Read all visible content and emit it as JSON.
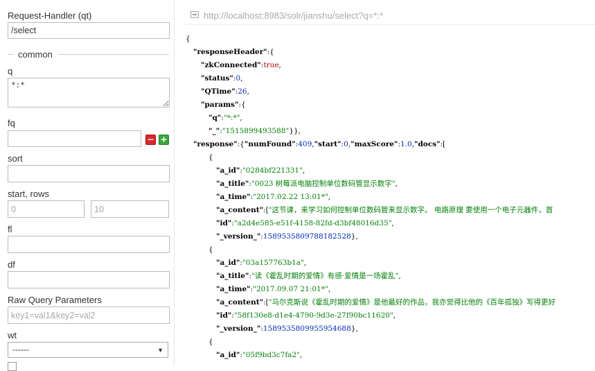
{
  "form": {
    "request_handler": {
      "label": "Request-Handler (qt)",
      "value": "/select"
    },
    "section_title": "common",
    "q": {
      "label": "q",
      "value": "*:*"
    },
    "fq": {
      "label": "fq",
      "value": ""
    },
    "sort": {
      "label": "sort",
      "value": ""
    },
    "start_rows": {
      "label": "start, rows",
      "start_placeholder": "0",
      "rows_placeholder": "10"
    },
    "fl": {
      "label": "fl",
      "value": ""
    },
    "df": {
      "label": "df",
      "value": ""
    },
    "raw_query": {
      "label": "Raw Query Parameters",
      "placeholder": "key1=val1&key2=val2"
    },
    "wt": {
      "label": "wt",
      "selected": "------"
    }
  },
  "url": "http://localhost:8983/solr/jianshu/select?q=*:*",
  "response_lines": [
    {
      "indent": 0,
      "tokens": [
        {
          "t": "p",
          "v": "{"
        }
      ]
    },
    {
      "indent": 1,
      "tokens": [
        {
          "t": "k",
          "v": "\"responseHeader\""
        },
        {
          "t": "p",
          "v": ":{"
        }
      ]
    },
    {
      "indent": 2,
      "tokens": [
        {
          "t": "k",
          "v": "\"zkConnected\""
        },
        {
          "t": "p",
          "v": ":"
        },
        {
          "t": "b",
          "v": "true"
        },
        {
          "t": "p",
          "v": ","
        }
      ]
    },
    {
      "indent": 2,
      "tokens": [
        {
          "t": "k",
          "v": "\"status\""
        },
        {
          "t": "p",
          "v": ":"
        },
        {
          "t": "n",
          "v": "0"
        },
        {
          "t": "p",
          "v": ","
        }
      ]
    },
    {
      "indent": 2,
      "tokens": [
        {
          "t": "k",
          "v": "\"QTime\""
        },
        {
          "t": "p",
          "v": ":"
        },
        {
          "t": "n",
          "v": "26"
        },
        {
          "t": "p",
          "v": ","
        }
      ]
    },
    {
      "indent": 2,
      "tokens": [
        {
          "t": "k",
          "v": "\"params\""
        },
        {
          "t": "p",
          "v": ":{"
        }
      ]
    },
    {
      "indent": 3,
      "tokens": [
        {
          "t": "k",
          "v": "\"q\""
        },
        {
          "t": "p",
          "v": ":"
        },
        {
          "t": "s",
          "v": "\"*:*\""
        },
        {
          "t": "p",
          "v": ","
        }
      ]
    },
    {
      "indent": 3,
      "tokens": [
        {
          "t": "k",
          "v": "\"_\""
        },
        {
          "t": "p",
          "v": ":"
        },
        {
          "t": "s",
          "v": "\"1515899493588\""
        },
        {
          "t": "p",
          "v": "}},"
        }
      ]
    },
    {
      "indent": 1,
      "tokens": [
        {
          "t": "k",
          "v": "\"response\""
        },
        {
          "t": "p",
          "v": ":{"
        },
        {
          "t": "k",
          "v": "\"numFound\""
        },
        {
          "t": "p",
          "v": ":"
        },
        {
          "t": "n",
          "v": "409"
        },
        {
          "t": "p",
          "v": ","
        },
        {
          "t": "k",
          "v": "\"start\""
        },
        {
          "t": "p",
          "v": ":"
        },
        {
          "t": "n",
          "v": "0"
        },
        {
          "t": "p",
          "v": ","
        },
        {
          "t": "k",
          "v": "\"maxScore\""
        },
        {
          "t": "p",
          "v": ":"
        },
        {
          "t": "n",
          "v": "1.0"
        },
        {
          "t": "p",
          "v": ","
        },
        {
          "t": "k",
          "v": "\"docs\""
        },
        {
          "t": "p",
          "v": ":["
        }
      ]
    },
    {
      "indent": 3,
      "tokens": [
        {
          "t": "p",
          "v": "{"
        }
      ]
    },
    {
      "indent": 4,
      "tokens": [
        {
          "t": "k",
          "v": "\"a_id\""
        },
        {
          "t": "p",
          "v": ":"
        },
        {
          "t": "s",
          "v": "\"0284bf221331\""
        },
        {
          "t": "p",
          "v": ","
        }
      ]
    },
    {
      "indent": 4,
      "tokens": [
        {
          "t": "k",
          "v": "\"a_title\""
        },
        {
          "t": "p",
          "v": ":"
        },
        {
          "t": "s",
          "v": "\"0023 树莓派电脑控制单位数码管显示数字\""
        },
        {
          "t": "p",
          "v": ","
        }
      ]
    },
    {
      "indent": 4,
      "tokens": [
        {
          "t": "k",
          "v": "\"a_time\""
        },
        {
          "t": "p",
          "v": ":"
        },
        {
          "t": "s",
          "v": "\"2017.02.22 13:01*\""
        },
        {
          "t": "p",
          "v": ","
        }
      ]
    },
    {
      "indent": 4,
      "tokens": [
        {
          "t": "k",
          "v": "\"a_content\""
        },
        {
          "t": "p",
          "v": ":["
        },
        {
          "t": "s",
          "v": "\"这节课，来学习如何控制单位数码管来显示数字。 电路原理 要使用一个电子元器件，首"
        }
      ]
    },
    {
      "indent": 4,
      "tokens": [
        {
          "t": "k",
          "v": "\"id\""
        },
        {
          "t": "p",
          "v": ":"
        },
        {
          "t": "s",
          "v": "\"a2d4e585-e51f-4158-82fd-d3bf48016d35\""
        },
        {
          "t": "p",
          "v": ","
        }
      ]
    },
    {
      "indent": 4,
      "tokens": [
        {
          "t": "k",
          "v": "\"_version_\""
        },
        {
          "t": "p",
          "v": ":"
        },
        {
          "t": "n",
          "v": "1589535809788182528"
        },
        {
          "t": "p",
          "v": "},"
        }
      ]
    },
    {
      "indent": 3,
      "tokens": [
        {
          "t": "p",
          "v": "{"
        }
      ]
    },
    {
      "indent": 4,
      "tokens": [
        {
          "t": "k",
          "v": "\"a_id\""
        },
        {
          "t": "p",
          "v": ":"
        },
        {
          "t": "s",
          "v": "\"03a157763b1a\""
        },
        {
          "t": "p",
          "v": ","
        }
      ]
    },
    {
      "indent": 4,
      "tokens": [
        {
          "t": "k",
          "v": "\"a_title\""
        },
        {
          "t": "p",
          "v": ":"
        },
        {
          "t": "s",
          "v": "\"读《霍乱时期的爱情》有感·爱情是一场霍乱\""
        },
        {
          "t": "p",
          "v": ","
        }
      ]
    },
    {
      "indent": 4,
      "tokens": [
        {
          "t": "k",
          "v": "\"a_time\""
        },
        {
          "t": "p",
          "v": ":"
        },
        {
          "t": "s",
          "v": "\"2017.09.07 21:01*\""
        },
        {
          "t": "p",
          "v": ","
        }
      ]
    },
    {
      "indent": 4,
      "tokens": [
        {
          "t": "k",
          "v": "\"a_content\""
        },
        {
          "t": "p",
          "v": ":["
        },
        {
          "t": "s",
          "v": "\"马尔克斯说《霍乱时期的爱情》是他最好的作品，我亦觉得比他的《百年孤独》写得更好"
        }
      ]
    },
    {
      "indent": 4,
      "tokens": [
        {
          "t": "k",
          "v": "\"id\""
        },
        {
          "t": "p",
          "v": ":"
        },
        {
          "t": "s",
          "v": "\"58f130e8-d1e4-4790-9d3e-27f90bc11620\""
        },
        {
          "t": "p",
          "v": ","
        }
      ]
    },
    {
      "indent": 4,
      "tokens": [
        {
          "t": "k",
          "v": "\"_version_\""
        },
        {
          "t": "p",
          "v": ":"
        },
        {
          "t": "n",
          "v": "1589535809955954688"
        },
        {
          "t": "p",
          "v": "},"
        }
      ]
    },
    {
      "indent": 3,
      "tokens": [
        {
          "t": "p",
          "v": "{"
        }
      ]
    },
    {
      "indent": 4,
      "tokens": [
        {
          "t": "k",
          "v": "\"a_id\""
        },
        {
          "t": "p",
          "v": ":"
        },
        {
          "t": "s",
          "v": "\"05f9bd3c7fa2\""
        },
        {
          "t": "p",
          "v": ","
        }
      ]
    }
  ]
}
